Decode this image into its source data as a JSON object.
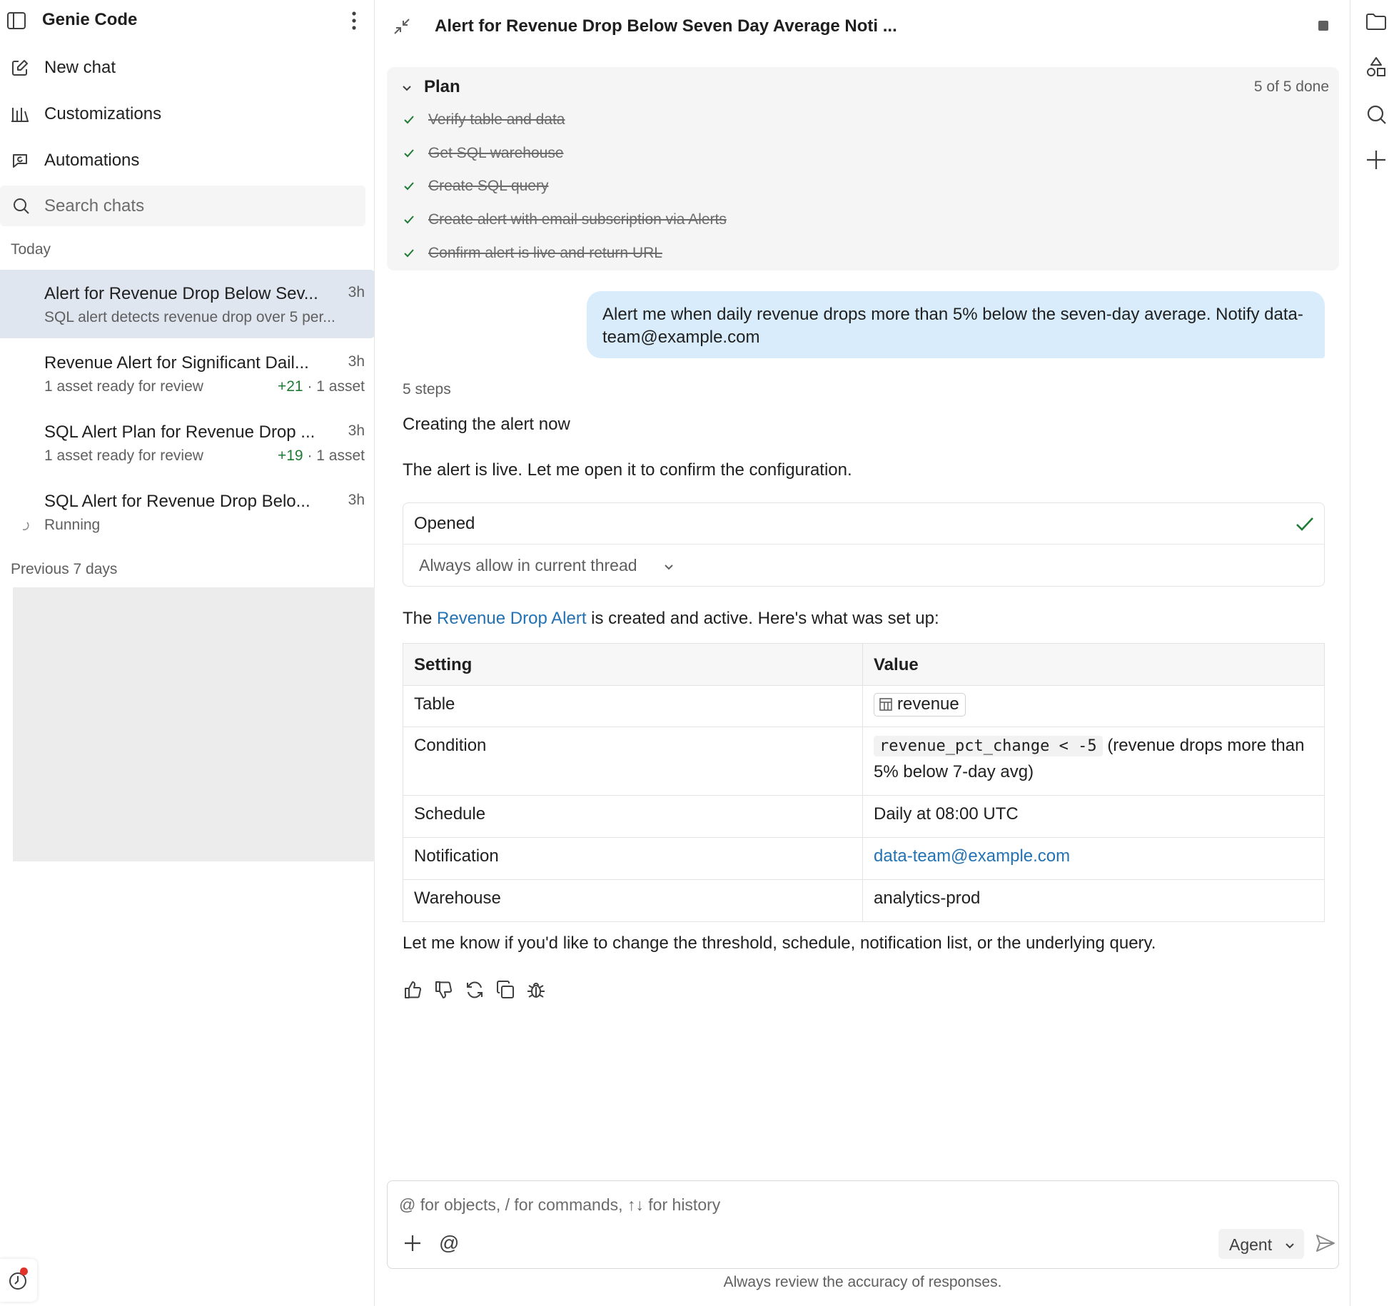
{
  "sidebar": {
    "title": "Genie Code",
    "nav": {
      "new_chat": "New chat",
      "customizations": "Customizations",
      "automations": "Automations"
    },
    "search_placeholder": "Search chats",
    "section_today": "Today",
    "section_previous": "Previous 7 days",
    "chats": [
      {
        "title": "Alert for Revenue Drop Below Sev...",
        "age": "3h",
        "subtitle": "SQL alert detects revenue drop over 5 per...",
        "active": true
      },
      {
        "title": "Revenue Alert for Significant Dail...",
        "age": "3h",
        "subtitle": "1 asset ready for review",
        "added": "+21",
        "assets": "· 1 asset"
      },
      {
        "title": "SQL Alert Plan for Revenue Drop ...",
        "age": "3h",
        "subtitle": "1 asset ready for review",
        "added": "+19",
        "assets": "· 1 asset"
      },
      {
        "title": "SQL Alert for Revenue Drop Belo...",
        "age": "3h",
        "subtitle": "Running"
      }
    ]
  },
  "main": {
    "title": "Alert for Revenue Drop Below Seven Day Average Noti ...",
    "plan": {
      "title": "Plan",
      "progress": "5 of 5 done",
      "steps": [
        "Verify table and data",
        "Get SQL warehouse",
        "Create SQL query",
        "Create alert with email subscription via Alerts",
        "Confirm alert is live and return URL"
      ]
    },
    "user_message": "Alert me when daily revenue drops more than 5% below the seven-day average. Notify data-team@example.com",
    "steps_label": "5 steps",
    "status_line": "Creating the alert now",
    "live_line": "The alert is live. Let me open it to confirm the configuration.",
    "tool": {
      "operation": "Opened",
      "permission": "Always allow in current thread"
    },
    "summary": {
      "prefix": "The",
      "link": "Revenue Drop Alert",
      "suffix": "is created and active. Here's what was set up:"
    },
    "table": {
      "headers": [
        "Setting",
        "Value"
      ],
      "rows": {
        "table": {
          "label": "Table",
          "value": "revenue"
        },
        "condition": {
          "label": "Condition",
          "code": "revenue_pct_change < -5",
          "note": "(revenue drops more than 5% below 7-day avg)"
        },
        "schedule": {
          "label": "Schedule",
          "value": "Daily at 08:00 UTC"
        },
        "notification": {
          "label": "Notification",
          "value": "data-team@example.com"
        },
        "warehouse": {
          "label": "Warehouse",
          "value": "analytics-prod"
        }
      }
    },
    "closing": "Let me know if you'd like to change the threshold, schedule, notification list, or the underlying query.",
    "composer": {
      "placeholder": "@ for objects, / for commands, ↑↓ for history",
      "at_symbol": "@",
      "mode": "Agent"
    },
    "disclaimer": "Always review the accuracy of responses."
  },
  "icons": {
    "sidebar_toggle": "sidebar-toggle-icon",
    "new_chat": "pencil-square-icon",
    "customizations": "bars-icon",
    "automations": "automation-icon",
    "search": "search-icon",
    "collapse": "collapse-icon",
    "stop": "stop-icon",
    "check": "check-icon",
    "thumbs_up": "thumbs-up-icon",
    "thumbs_down": "thumbs-down-icon",
    "regenerate": "refresh-icon",
    "copy": "copy-icon",
    "bug": "bug-icon",
    "send": "send-icon",
    "folder": "folder-icon",
    "shapes": "shapes-icon",
    "plus": "plus-icon"
  },
  "colors": {
    "accent_link": "#2272b4",
    "success": "#1e7b34",
    "user_bubble": "#d8ecfb",
    "active_chat": "#dfe6ef",
    "notification_dot": "#e0312b"
  }
}
